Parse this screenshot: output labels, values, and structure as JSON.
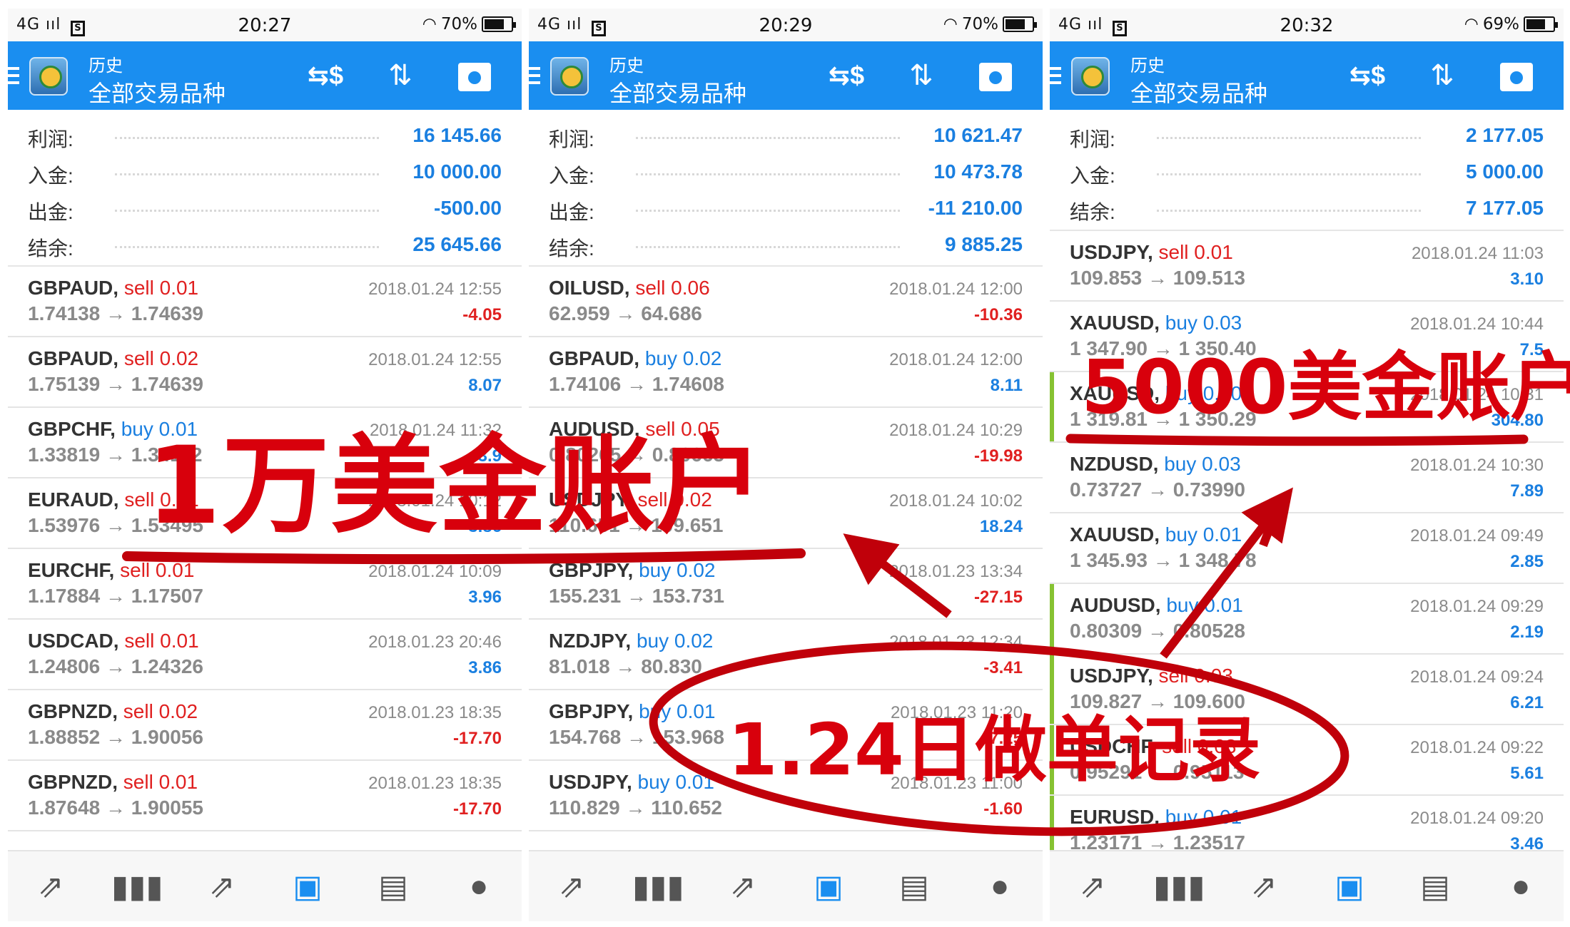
{
  "phones": [
    {
      "status": {
        "network": "4G ııl",
        "sim_badge": "S",
        "time": "20:27",
        "wifi": "wifi-icon",
        "battery_text": "70%",
        "battery_level": 0.7
      },
      "appbar": {
        "subtitle": "历史",
        "title": "全部交易品种"
      },
      "summary": [
        {
          "label": "利润:",
          "value": "16 145.66"
        },
        {
          "label": "入金:",
          "value": "10 000.00"
        },
        {
          "label": "出金:",
          "value": "-500.00"
        },
        {
          "label": "结余:",
          "value": "25 645.66"
        }
      ],
      "trades": [
        {
          "symbol": "GBPAUD,",
          "side": "sell",
          "lots": "0.01",
          "open": "1.74138",
          "close": "1.74639",
          "time": "2018.01.24 12:55",
          "profit": "-4.05"
        },
        {
          "symbol": "GBPAUD,",
          "side": "sell",
          "lots": "0.02",
          "open": "1.75139",
          "close": "1.74639",
          "time": "2018.01.24 12:55",
          "profit": "8.07"
        },
        {
          "symbol": "GBPCHF,",
          "side": "buy",
          "lots": "0.01",
          "open": "1.33819",
          "close": "1.34112",
          "time": "2018.01.24 11:32",
          "profit": "3.9"
        },
        {
          "symbol": "EURAUD,",
          "side": "sell",
          "lots": "0.01",
          "open": "1.53976",
          "close": "1.53495",
          "time": "2018.01.24 10:12",
          "profit": "3.86"
        },
        {
          "symbol": "EURCHF,",
          "side": "sell",
          "lots": "0.01",
          "open": "1.17884",
          "close": "1.17507",
          "time": "2018.01.24 10:09",
          "profit": "3.96"
        },
        {
          "symbol": "USDCAD,",
          "side": "sell",
          "lots": "0.01",
          "open": "1.24806",
          "close": "1.24326",
          "time": "2018.01.23 20:46",
          "profit": "3.86"
        },
        {
          "symbol": "GBPNZD,",
          "side": "sell",
          "lots": "0.02",
          "open": "1.88852",
          "close": "1.90056",
          "time": "2018.01.23 18:35",
          "profit": "-17.70"
        },
        {
          "symbol": "GBPNZD,",
          "side": "sell",
          "lots": "0.01",
          "open": "1.87648",
          "close": "1.90055",
          "time": "2018.01.23 18:35",
          "profit": "-17.70"
        }
      ]
    },
    {
      "status": {
        "network": "4G ııl",
        "sim_badge": "S",
        "time": "20:29",
        "wifi": "wifi-icon",
        "battery_text": "70%",
        "battery_level": 0.7
      },
      "appbar": {
        "subtitle": "历史",
        "title": "全部交易品种"
      },
      "summary": [
        {
          "label": "利润:",
          "value": "10 621.47"
        },
        {
          "label": "入金:",
          "value": "10 473.78"
        },
        {
          "label": "出金:",
          "value": "-11 210.00"
        },
        {
          "label": "结余:",
          "value": "9 885.25"
        }
      ],
      "trades": [
        {
          "symbol": "OILUSD,",
          "side": "sell",
          "lots": "0.06",
          "open": "62.959",
          "close": "64.686",
          "time": "2018.01.24 12:00",
          "profit": "-10.36"
        },
        {
          "symbol": "GBPAUD,",
          "side": "buy",
          "lots": "0.02",
          "open": "1.74106",
          "close": "1.74608",
          "time": "2018.01.24 12:00",
          "profit": "8.11"
        },
        {
          "symbol": "AUDUSD,",
          "side": "sell",
          "lots": "0.05",
          "open": "0.80265",
          "close": "0.80665",
          "time": "2018.01.24 10:29",
          "profit": "-19.98"
        },
        {
          "symbol": "USDJPY,",
          "side": "sell",
          "lots": "0.02",
          "open": "110.651",
          "close": "109.651",
          "time": "2018.01.24 10:02",
          "profit": "18.24"
        },
        {
          "symbol": "GBPJPY,",
          "side": "buy",
          "lots": "0.02",
          "open": "155.231",
          "close": "153.731",
          "time": "2018.01.23 13:34",
          "profit": "-27.15"
        },
        {
          "symbol": "NZDJPY,",
          "side": "buy",
          "lots": "0.02",
          "open": "81.018",
          "close": "80.830",
          "time": "2018.01.23 12:34",
          "profit": "-3.41"
        },
        {
          "symbol": "GBPJPY,",
          "side": "buy",
          "lots": "0.01",
          "open": "154.768",
          "close": "153.968",
          "time": "2018.01.23 11:20",
          "profit": "-7.25"
        },
        {
          "symbol": "USDJPY,",
          "side": "buy",
          "lots": "0.01",
          "open": "110.829",
          "close": "110.652",
          "time": "2018.01.23 11:00",
          "profit": "-1.60"
        }
      ]
    },
    {
      "status": {
        "network": "4G ııl",
        "sim_badge": "S",
        "time": "20:32",
        "wifi": "wifi-icon",
        "battery_text": "69%",
        "battery_level": 0.69
      },
      "appbar": {
        "subtitle": "历史",
        "title": "全部交易品种"
      },
      "summary": [
        {
          "label": "利润:",
          "value": "2 177.05"
        },
        {
          "label": "入金:",
          "value": "5 000.00"
        },
        {
          "label": "结余:",
          "value": "7 177.05"
        }
      ],
      "trades": [
        {
          "symbol": "USDJPY,",
          "side": "sell",
          "lots": "0.01",
          "open": "109.853",
          "close": "109.513",
          "time": "2018.01.24 11:03",
          "profit": "3.10",
          "bar": false
        },
        {
          "symbol": "XAUUSD,",
          "side": "buy",
          "lots": "0.03",
          "open": "1 347.90",
          "close": "1 350.40",
          "time": "2018.01.24 10:44",
          "profit": "7.5",
          "bar": false
        },
        {
          "symbol": "XAUUSD,",
          "side": "buy",
          "lots": "0.10",
          "open": "1 319.81",
          "close": "1 350.29",
          "time": "2018.01.24 10:31",
          "profit": "304.80",
          "bar": true
        },
        {
          "symbol": "NZDUSD,",
          "side": "buy",
          "lots": "0.03",
          "open": "0.73727",
          "close": "0.73990",
          "time": "2018.01.24 10:30",
          "profit": "7.89",
          "bar": false
        },
        {
          "symbol": "XAUUSD,",
          "side": "buy",
          "lots": "0.01",
          "open": "1 345.93",
          "close": "1 348.78",
          "time": "2018.01.24 09:49",
          "profit": "2.85",
          "bar": false
        },
        {
          "symbol": "AUDUSD,",
          "side": "buy",
          "lots": "0.01",
          "open": "0.80309",
          "close": "0.80528",
          "time": "2018.01.24 09:29",
          "profit": "2.19",
          "bar": true
        },
        {
          "symbol": "USDJPY,",
          "side": "sell",
          "lots": "0.03",
          "open": "109.827",
          "close": "109.600",
          "time": "2018.01.24 09:24",
          "profit": "6.21",
          "bar": true
        },
        {
          "symbol": "USDCHF,",
          "side": "sell",
          "lots": "0.03",
          "open": "0.95291",
          "close": "0.95113",
          "time": "2018.01.24 09:22",
          "profit": "5.61",
          "bar": true
        },
        {
          "symbol": "EURUSD,",
          "side": "buy",
          "lots": "0.01",
          "open": "1.23171",
          "close": "1.23517",
          "time": "2018.01.24 09:20",
          "profit": "3.46",
          "bar": true
        }
      ]
    }
  ],
  "annotations": {
    "account_10k": "1万美金账户",
    "account_5k": "5000美金账户",
    "record_label": "1.24日做单记录",
    "color": "#d8000c"
  },
  "icons": {
    "appbar": [
      "menu-icon",
      "currency-exchange-icon",
      "sort-icon",
      "calendar-icon"
    ],
    "nav": [
      "quotes-icon",
      "chart-icon",
      "trade-icon",
      "history-icon",
      "news-icon",
      "chat-icon"
    ]
  }
}
